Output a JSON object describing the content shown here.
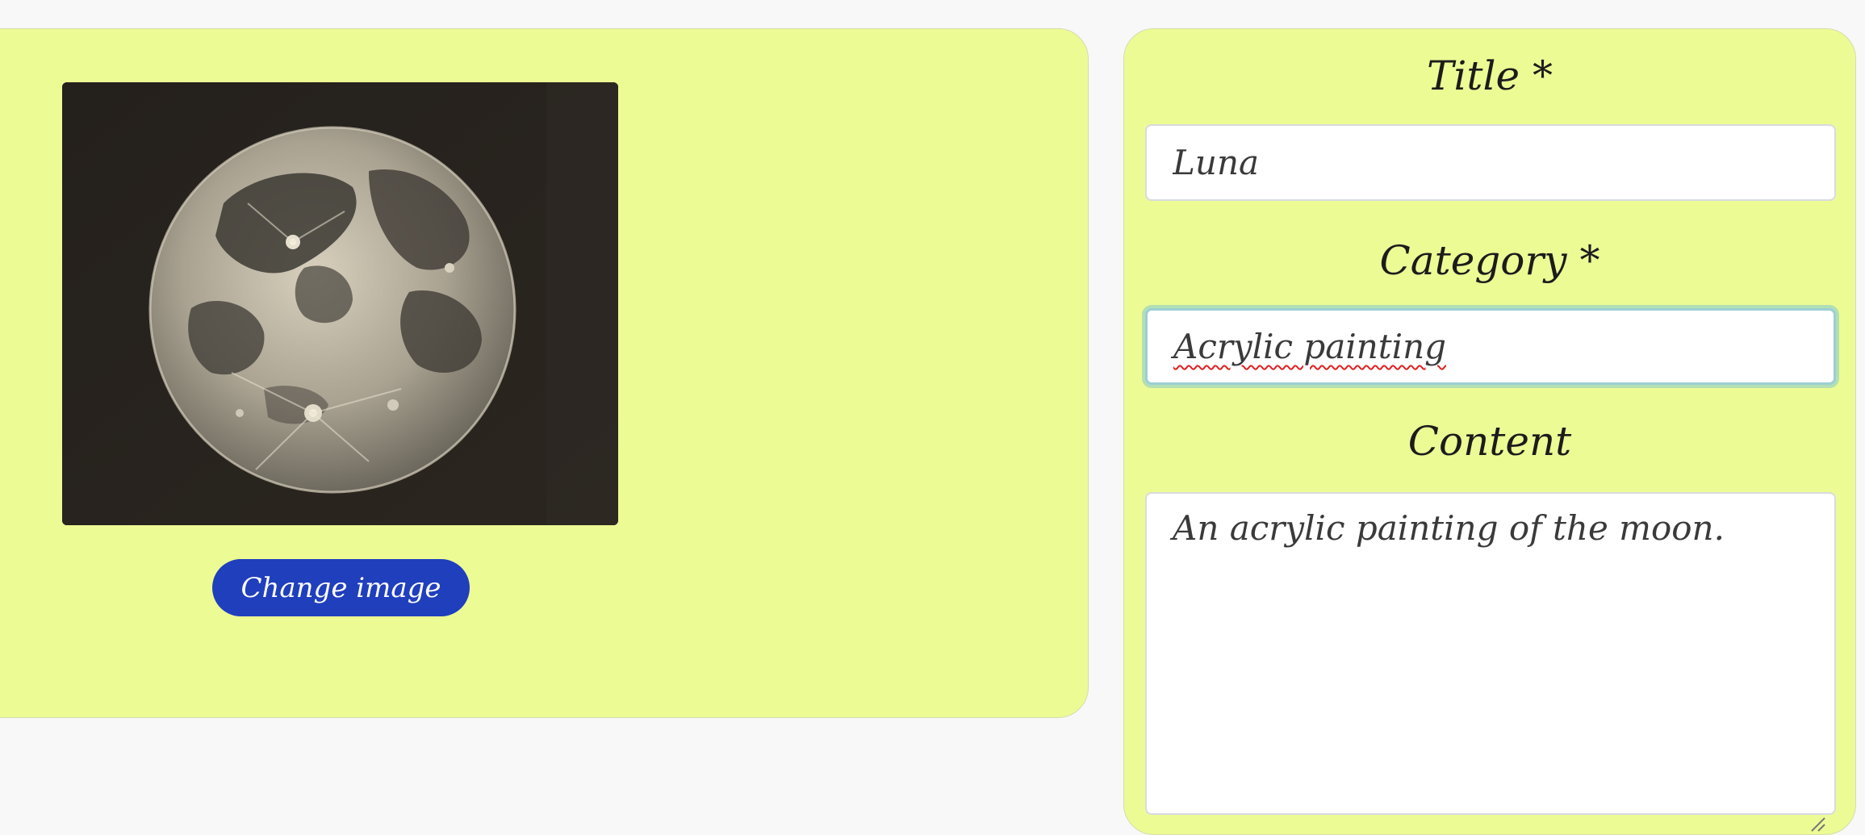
{
  "image_panel": {
    "artwork_alt": "Moon painting",
    "change_image_label": "Change image"
  },
  "form": {
    "title_label": "Title *",
    "title_value": "Luna",
    "category_label": "Category *",
    "category_value": "Acrylic painting",
    "content_label": "Content",
    "content_value": "An acrylic painting of the moon."
  },
  "colors": {
    "card_background": "#edfb95",
    "button_background": "#1f3fbd",
    "page_background": "#f8f8f8"
  },
  "icons": {
    "resize": "resize-handle-icon"
  }
}
